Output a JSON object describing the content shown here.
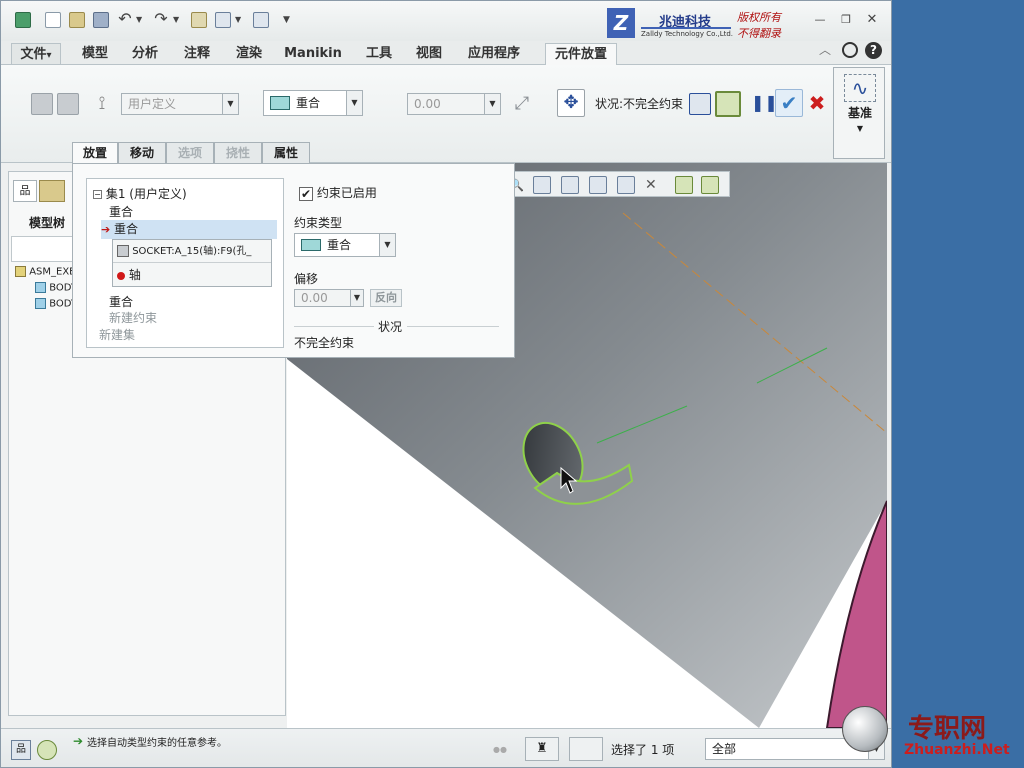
{
  "logo": {
    "company_cn": "兆迪科技",
    "company_en": "Zalldy Technology Co.,Ltd.",
    "rights_1": "版权所有",
    "rights_2": "不得翻录"
  },
  "tabs": [
    {
      "label": "文件",
      "arrow": "▾"
    },
    {
      "label": "模型"
    },
    {
      "label": "分析"
    },
    {
      "label": "注释"
    },
    {
      "label": "渲染"
    },
    {
      "label": "Manikin"
    },
    {
      "label": "工具"
    },
    {
      "label": "视图"
    },
    {
      "label": "应用程序"
    },
    {
      "label": "元件放置"
    }
  ],
  "ribbon": {
    "user_defined_combo": "用户定义",
    "constraint_combo": "重合",
    "offset_value": "0.00",
    "status_label": "状况:不完全约束",
    "datum_label": "基准"
  },
  "place_tabs": [
    "放置",
    "移动",
    "选项",
    "挠性",
    "属性"
  ],
  "placement": {
    "set_title": "集1 (用户定义)",
    "constraint_1": "重合",
    "constraint_2": "重合",
    "ref_1": "SOCKET:A_15(轴):F9(孔_",
    "ref_2": "轴",
    "constraint_3": "重合",
    "new_constraint": "新建约束",
    "new_set": "新建集",
    "enabled_label": "约束已启用",
    "type_label": "约束类型",
    "type_value": "重合",
    "offset_label": "偏移",
    "offset_value": "0.00",
    "flip_button": "反向",
    "status_header": "状况",
    "status_value": "不完全约束"
  },
  "left_panel": {
    "title": "模型树",
    "tree": [
      "ASM_EXE",
      "BODY",
      "BODY"
    ]
  },
  "status_bar": {
    "message": "选择自动类型约束的任意参考。",
    "selected": "选择了 1 项",
    "filter": "全部"
  },
  "watermark": {
    "cn": "专职网",
    "url": "Zhuanzhi.Net"
  },
  "colors": {
    "ok_check": "#3a7fc4",
    "cancel_x": "#cc1e1e",
    "pause": "#2a4f9a",
    "highlight_edge": "#8fd14a",
    "model_pink": "#c0558a"
  }
}
